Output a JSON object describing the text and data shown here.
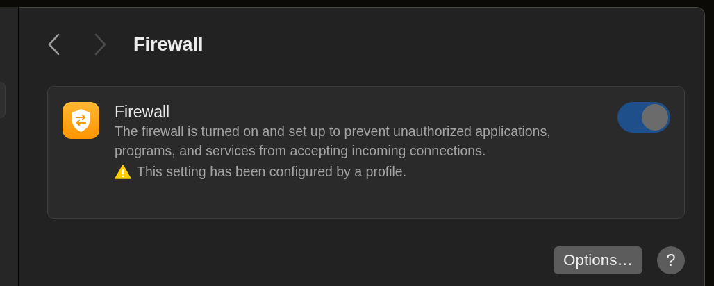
{
  "toolbar": {
    "back": {
      "disabled": false
    },
    "forward": {
      "disabled": true
    },
    "title": "Firewall"
  },
  "setting": {
    "title": "Firewall",
    "description": "The firewall is turned on and set up to prevent unauthorized applications, programs, and services from accepting incoming connections.",
    "warning": "This setting has been configured by a profile.",
    "toggle": {
      "on": true,
      "disabled": true
    }
  },
  "buttons": [
    {
      "kind": "text",
      "label": "Options…"
    },
    {
      "kind": "help",
      "label": "?"
    }
  ]
}
